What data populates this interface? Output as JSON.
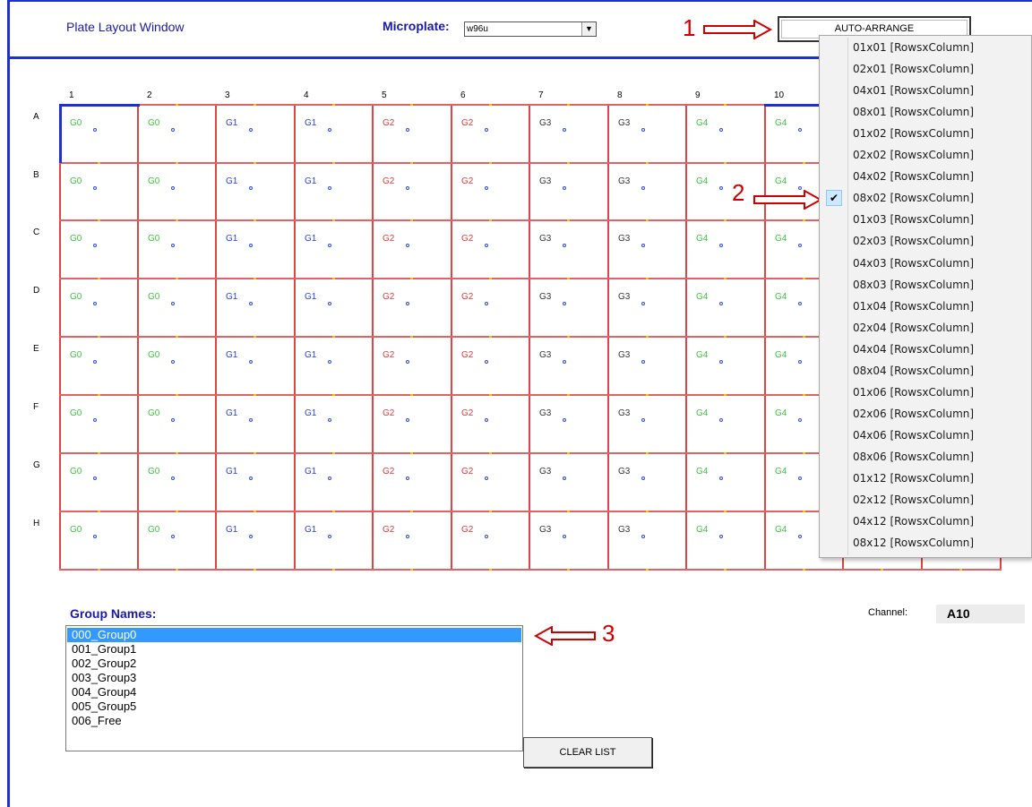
{
  "window": {
    "title": "Plate Layout Window"
  },
  "microplate": {
    "label": "Microplate:",
    "value": "w96u"
  },
  "auto_arrange": {
    "label": "AUTO-ARRANGE"
  },
  "annotations": {
    "a1": "1",
    "a2": "2",
    "a3": "3"
  },
  "grid": {
    "columns": [
      "1",
      "2",
      "3",
      "4",
      "5",
      "6",
      "7",
      "8",
      "9",
      "10"
    ],
    "rows": [
      "A",
      "B",
      "C",
      "D",
      "E",
      "F",
      "G",
      "H"
    ],
    "column_groups": [
      "G0",
      "G0",
      "G1",
      "G1",
      "G2",
      "G2",
      "G3",
      "G3",
      "G4",
      "G4"
    ],
    "group_colors": {
      "G0": "#3ec43e",
      "G1": "#2a3fd6",
      "G2": "#e03a3a",
      "G3": "#333333",
      "G4": "#3ec43e"
    }
  },
  "arrange_menu": {
    "items": [
      "01x01 [RowsxColumn]",
      "02x01 [RowsxColumn]",
      "04x01 [RowsxColumn]",
      "08x01 [RowsxColumn]",
      "01x02 [RowsxColumn]",
      "02x02 [RowsxColumn]",
      "04x02 [RowsxColumn]",
      "08x02 [RowsxColumn]",
      "01x03 [RowsxColumn]",
      "02x03 [RowsxColumn]",
      "04x03 [RowsxColumn]",
      "08x03 [RowsxColumn]",
      "01x04 [RowsxColumn]",
      "02x04 [RowsxColumn]",
      "04x04 [RowsxColumn]",
      "08x04 [RowsxColumn]",
      "01x06 [RowsxColumn]",
      "02x06 [RowsxColumn]",
      "04x06 [RowsxColumn]",
      "08x06 [RowsxColumn]",
      "01x12 [RowsxColumn]",
      "02x12 [RowsxColumn]",
      "04x12 [RowsxColumn]",
      "08x12 [RowsxColumn]"
    ],
    "checked_index": 7,
    "check_icon": "checkmark-icon"
  },
  "group_names": {
    "label": "Group Names:",
    "items": [
      "000_Group0",
      "001_Group1",
      "002_Group2",
      "003_Group3",
      "004_Group4",
      "005_Group5",
      "006_Free"
    ],
    "selected_index": 0
  },
  "clear_button": {
    "label": "CLEAR LIST"
  },
  "channel": {
    "label": "Channel:",
    "value": "A10"
  }
}
